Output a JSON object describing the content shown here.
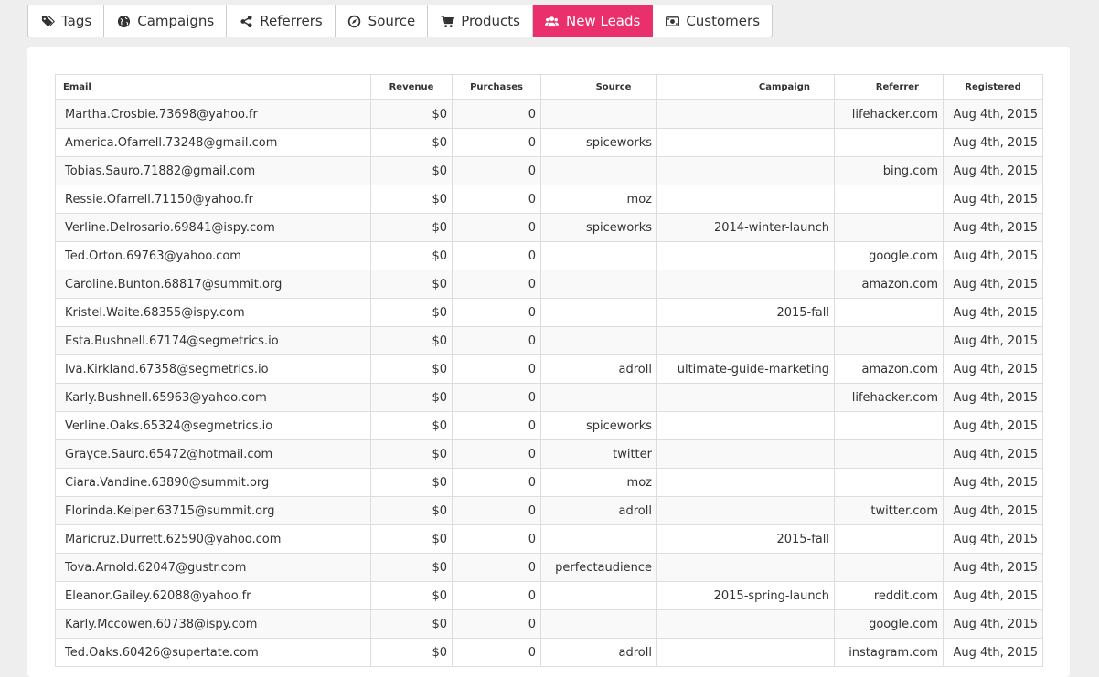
{
  "tabs": [
    {
      "label": "Tags",
      "icon": "tags-icon",
      "active": false
    },
    {
      "label": "Campaigns",
      "icon": "globe-icon",
      "active": false
    },
    {
      "label": "Referrers",
      "icon": "share-icon",
      "active": false
    },
    {
      "label": "Source",
      "icon": "compass-icon",
      "active": false
    },
    {
      "label": "Products",
      "icon": "cart-icon",
      "active": false
    },
    {
      "label": "New Leads",
      "icon": "users-icon",
      "active": true
    },
    {
      "label": "Customers",
      "icon": "money-icon",
      "active": false
    }
  ],
  "colors": {
    "accent": "#ea2f6d",
    "background": "#eeeeee",
    "panel": "#ffffff",
    "border": "#dddddd",
    "stripe": "#f9f9f9"
  },
  "table": {
    "columns": [
      "Email",
      "Revenue",
      "Purchases",
      "Source",
      "Campaign",
      "Referrer",
      "Registered"
    ],
    "rows": [
      [
        "Martha.Crosbie.73698@yahoo.fr",
        "$0",
        "0",
        "",
        "",
        "lifehacker.com",
        "Aug 4th, 2015"
      ],
      [
        "America.Ofarrell.73248@gmail.com",
        "$0",
        "0",
        "spiceworks",
        "",
        "",
        "Aug 4th, 2015"
      ],
      [
        "Tobias.Sauro.71882@gmail.com",
        "$0",
        "0",
        "",
        "",
        "bing.com",
        "Aug 4th, 2015"
      ],
      [
        "Ressie.Ofarrell.71150@yahoo.fr",
        "$0",
        "0",
        "moz",
        "",
        "",
        "Aug 4th, 2015"
      ],
      [
        "Verline.Delrosario.69841@ispy.com",
        "$0",
        "0",
        "spiceworks",
        "2014-winter-launch",
        "",
        "Aug 4th, 2015"
      ],
      [
        "Ted.Orton.69763@yahoo.com",
        "$0",
        "0",
        "",
        "",
        "google.com",
        "Aug 4th, 2015"
      ],
      [
        "Caroline.Bunton.68817@summit.org",
        "$0",
        "0",
        "",
        "",
        "amazon.com",
        "Aug 4th, 2015"
      ],
      [
        "Kristel.Waite.68355@ispy.com",
        "$0",
        "0",
        "",
        "2015-fall",
        "",
        "Aug 4th, 2015"
      ],
      [
        "Esta.Bushnell.67174@segmetrics.io",
        "$0",
        "0",
        "",
        "",
        "",
        "Aug 4th, 2015"
      ],
      [
        "Iva.Kirkland.67358@segmetrics.io",
        "$0",
        "0",
        "adroll",
        "ultimate-guide-marketing",
        "amazon.com",
        "Aug 4th, 2015"
      ],
      [
        "Karly.Bushnell.65963@yahoo.com",
        "$0",
        "0",
        "",
        "",
        "lifehacker.com",
        "Aug 4th, 2015"
      ],
      [
        "Verline.Oaks.65324@segmetrics.io",
        "$0",
        "0",
        "spiceworks",
        "",
        "",
        "Aug 4th, 2015"
      ],
      [
        "Grayce.Sauro.65472@hotmail.com",
        "$0",
        "0",
        "twitter",
        "",
        "",
        "Aug 4th, 2015"
      ],
      [
        "Ciara.Vandine.63890@summit.org",
        "$0",
        "0",
        "moz",
        "",
        "",
        "Aug 4th, 2015"
      ],
      [
        "Florinda.Keiper.63715@summit.org",
        "$0",
        "0",
        "adroll",
        "",
        "twitter.com",
        "Aug 4th, 2015"
      ],
      [
        "Maricruz.Durrett.62590@yahoo.com",
        "$0",
        "0",
        "",
        "2015-fall",
        "",
        "Aug 4th, 2015"
      ],
      [
        "Tova.Arnold.62047@gustr.com",
        "$0",
        "0",
        "perfectaudience",
        "",
        "",
        "Aug 4th, 2015"
      ],
      [
        "Eleanor.Gailey.62088@yahoo.fr",
        "$0",
        "0",
        "",
        "2015-spring-launch",
        "reddit.com",
        "Aug 4th, 2015"
      ],
      [
        "Karly.Mccowen.60738@ispy.com",
        "$0",
        "0",
        "",
        "",
        "google.com",
        "Aug 4th, 2015"
      ],
      [
        "Ted.Oaks.60426@supertate.com",
        "$0",
        "0",
        "adroll",
        "",
        "instagram.com",
        "Aug 4th, 2015"
      ]
    ]
  }
}
